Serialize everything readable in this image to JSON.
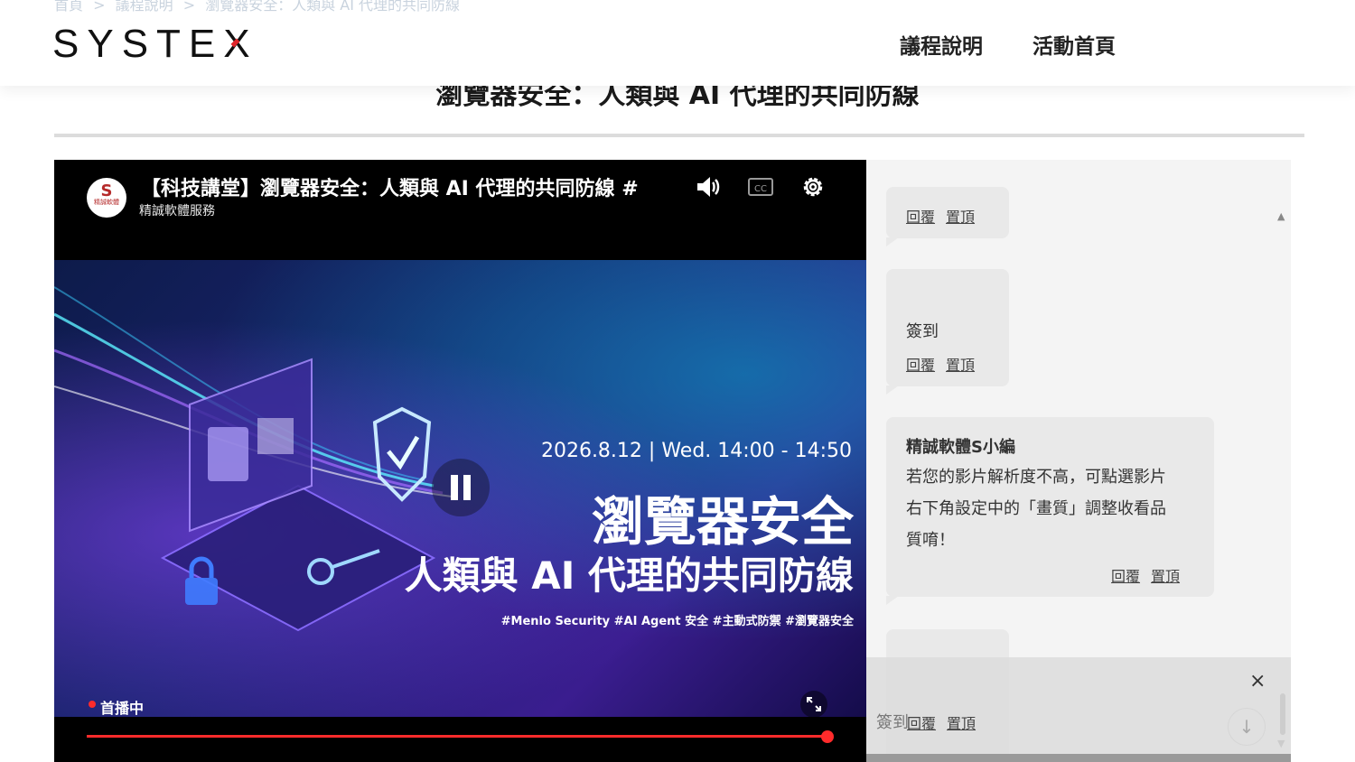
{
  "breadcrumb": {
    "home": "首頁",
    "sep1": ">",
    "section": "議程說明",
    "sep2": ">",
    "current": "瀏覽器安全：人類與 AI 代理的共同防線"
  },
  "header": {
    "logo": "SYSTEX",
    "nav": [
      "議程說明",
      "活動首頁"
    ]
  },
  "page_title": "瀏覽器安全：人類與 AI 代理的共同防線",
  "player": {
    "video_title": "【科技講堂】瀏覽器安全：人類與 AI 代理的共同防線 #",
    "channel_name": "精誠軟體服務",
    "avatar_text": "精誠軟體",
    "frame": {
      "date_line": "2026.8.12 | Wed. 14:00 - 14:50",
      "headline": "瀏覽器安全",
      "subheadline": "人類與 AI 代理的共同防線",
      "hashtags": "#Menlo Security #AI Agent 安全 #主動式防禦 #瀏覽器安全"
    },
    "live_label": "首播中",
    "progress_percent": 100,
    "icons": [
      "volume-icon",
      "closed-caption-icon",
      "settings-icon",
      "pause-icon",
      "fullscreen-icon"
    ],
    "accent_color": "#ff2b2b"
  },
  "chat": {
    "reply_label": "回覆",
    "pin_label": "置頂",
    "messages": [
      {
        "text": ""
      },
      {
        "text": "簽到"
      },
      {
        "author": "精誠軟體S小編",
        "lines": [
          "若您的影片解析度不高，可點選影片",
          "右下角設定中的「畫質」調整收看品",
          "質唷！"
        ]
      },
      {
        "text": "簽到"
      }
    ],
    "overlay_close": "×",
    "overlay_text": "簽到",
    "jump_down": "↓",
    "scroll_up": "▲",
    "scroll_down": "▼"
  }
}
